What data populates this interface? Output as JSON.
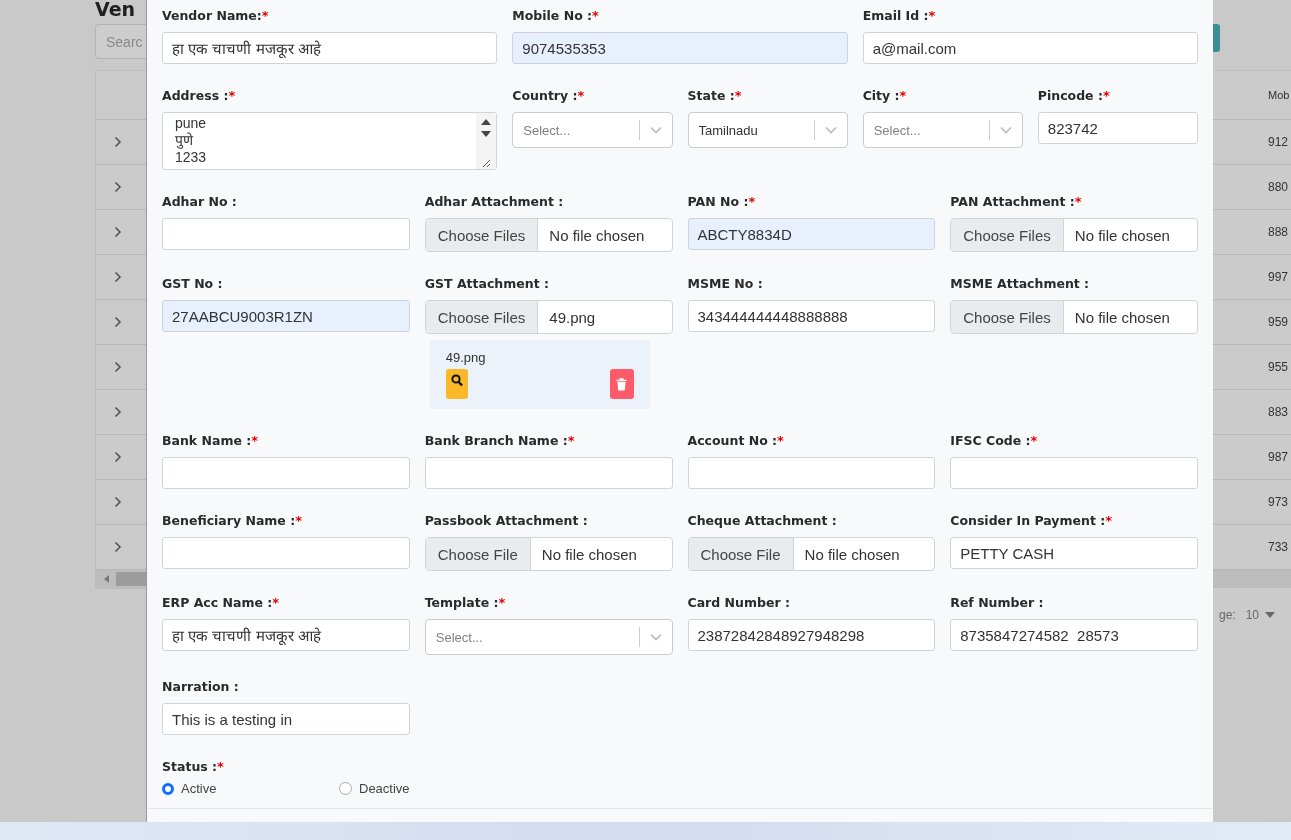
{
  "background_page": {
    "heading": "Ven",
    "search": {
      "placeholder": "Searc"
    },
    "table": {
      "header": "Mob",
      "rows": [
        {
          "mobile": "912"
        },
        {
          "mobile": "880"
        },
        {
          "mobile": "888"
        },
        {
          "mobile": "997"
        },
        {
          "mobile": "959"
        },
        {
          "mobile": "955"
        },
        {
          "mobile": "883"
        },
        {
          "mobile": "987"
        },
        {
          "mobile": "973"
        },
        {
          "mobile": "733"
        }
      ]
    },
    "pagination": {
      "label": "ge:",
      "page_size": "10"
    }
  },
  "form": {
    "rows": [
      [
        {
          "kind": "text",
          "label": "Vendor Name:",
          "required_mark": "*",
          "value": "हा एक चाचणी मजकूर आहे",
          "autofilled": false
        },
        {
          "kind": "text",
          "label": "Mobile No :",
          "required_mark": "*",
          "value": "9074535353",
          "autofilled": true
        },
        {
          "kind": "text",
          "label": "Email Id :",
          "required_mark": "*",
          "value": "a@mail.com",
          "autofilled": false
        }
      ],
      [
        {
          "kind": "textarea",
          "label": "Address :",
          "required_mark": "*",
          "value": "pune\nपुणे\n1233"
        },
        {
          "kind": "select",
          "label": "Country :",
          "required_mark": "*",
          "placeholder": "Select..."
        },
        {
          "kind": "select",
          "label": "State :",
          "required_mark": "*",
          "value": "Tamilnadu"
        },
        {
          "kind": "select",
          "label": "City :",
          "required_mark": "*",
          "placeholder": "Select..."
        },
        {
          "kind": "text",
          "label": "Pincode :",
          "required_mark": "*",
          "value": "823742",
          "autofilled": false
        }
      ],
      [
        {
          "kind": "text",
          "label": "Adhar No :",
          "autofilled": false
        },
        {
          "kind": "file",
          "label": "Adhar Attachment :",
          "button": "Choose Files",
          "file_text": "No file chosen"
        },
        {
          "kind": "text",
          "label": "PAN No :",
          "required_mark": "*",
          "value": "ABCTY8834D",
          "autofilled": true
        },
        {
          "kind": "file",
          "label": "PAN Attachment :",
          "required_mark": "*",
          "button": "Choose Files",
          "file_text": "No file chosen"
        }
      ],
      [
        {
          "kind": "text",
          "label": "GST No :",
          "value": "27AABCU9003R1ZN",
          "autofilled": true
        },
        {
          "kind": "file",
          "label": "GST Attachment :",
          "button": "Choose Files",
          "file_text": "49.png",
          "preview": {
            "file_name": "49.png"
          }
        },
        {
          "kind": "text",
          "label": "MSME No :",
          "value": "343444444448888888",
          "autofilled": false
        },
        {
          "kind": "file",
          "label": "MSME Attachment :",
          "button": "Choose Files",
          "file_text": "No file chosen"
        }
      ],
      [
        {
          "kind": "text",
          "label": "Bank Name :",
          "required_mark": "*",
          "autofilled": false
        },
        {
          "kind": "text",
          "label": "Bank Branch Name :",
          "required_mark": "*",
          "autofilled": false
        },
        {
          "kind": "text",
          "label": "Account No :",
          "required_mark": "*",
          "autofilled": false
        },
        {
          "kind": "text",
          "label": "IFSC Code :",
          "required_mark": "*",
          "autofilled": false
        }
      ],
      [
        {
          "kind": "text",
          "label": "Beneficiary Name :",
          "required_mark": "*",
          "autofilled": false
        },
        {
          "kind": "file",
          "label": "Passbook Attachment :",
          "button": "Choose File",
          "file_text": "No file chosen"
        },
        {
          "kind": "file",
          "label": "Cheque Attachment :",
          "button": "Choose File",
          "file_text": "No file chosen"
        },
        {
          "kind": "text",
          "label": "Consider In Payment :",
          "required_mark": "*",
          "value": "PETTY CASH",
          "autofilled": false
        }
      ],
      [
        {
          "kind": "text",
          "label": "ERP Acc Name :",
          "required_mark": "*",
          "value": "हा एक चाचणी मजकूर आहे",
          "autofilled": false
        },
        {
          "kind": "select",
          "label": "Template :",
          "required_mark": "*",
          "placeholder": "Select..."
        },
        {
          "kind": "text",
          "label": "Card Number :",
          "value": "23872842848927948298",
          "autofilled": false
        },
        {
          "kind": "text",
          "label": "Ref Number :",
          "value": "8735847274582  28573",
          "autofilled": false
        }
      ],
      [
        {
          "kind": "text",
          "label": "Narration :",
          "value": "This is a testing in",
          "autofilled": false
        }
      ]
    ],
    "status": {
      "label": "Status :",
      "required_mark": "*",
      "options": [
        {
          "label": "Active",
          "selected": true
        },
        {
          "label": "Deactive",
          "selected": false
        }
      ]
    }
  }
}
